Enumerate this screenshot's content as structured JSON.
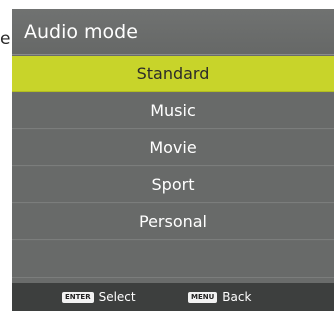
{
  "edge_text": "e",
  "menu": {
    "title": "Audio mode",
    "items": [
      {
        "label": "Standard",
        "selected": true
      },
      {
        "label": "Music",
        "selected": false
      },
      {
        "label": "Movie",
        "selected": false
      },
      {
        "label": "Sport",
        "selected": false
      },
      {
        "label": "Personal",
        "selected": false
      }
    ]
  },
  "footer": {
    "enter_key": "ENTER",
    "enter_label": "Select",
    "menu_key": "MENU",
    "menu_label": "Back"
  },
  "colors": {
    "panel": "#6a6c6b",
    "selected": "#c8d42a",
    "footer": "#3d3f3e"
  }
}
